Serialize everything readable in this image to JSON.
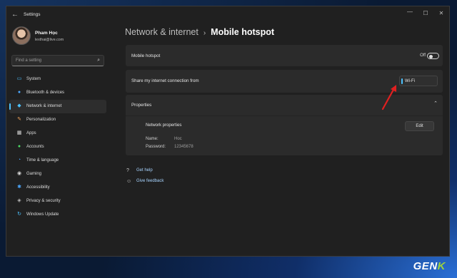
{
  "window": {
    "title": "Settings",
    "controls": {
      "minimize": "—",
      "maximize": "☐",
      "close": "✕"
    }
  },
  "user": {
    "name": "Pham Học",
    "email": "lexthai@live.com"
  },
  "search": {
    "placeholder": "Find a setting"
  },
  "sidebar": {
    "items": [
      {
        "label": "System",
        "icon": "system-icon",
        "color": "#4cc2ff"
      },
      {
        "label": "Bluetooth & devices",
        "icon": "bluetooth-icon",
        "color": "#4ca8ff"
      },
      {
        "label": "Network & internet",
        "icon": "wifi-icon",
        "color": "#4cc2ff",
        "active": true
      },
      {
        "label": "Personalization",
        "icon": "brush-icon",
        "color": "#f2a35a"
      },
      {
        "label": "Apps",
        "icon": "apps-icon",
        "color": "#d8d8d8"
      },
      {
        "label": "Accounts",
        "icon": "person-icon",
        "color": "#4cd964"
      },
      {
        "label": "Time & language",
        "icon": "clock-icon",
        "color": "#4ca8ff"
      },
      {
        "label": "Gaming",
        "icon": "controller-icon",
        "color": "#d8d8d8"
      },
      {
        "label": "Accessibility",
        "icon": "accessibility-icon",
        "color": "#4ca8ff"
      },
      {
        "label": "Privacy & security",
        "icon": "shield-icon",
        "color": "#bdbdbd"
      },
      {
        "label": "Windows Update",
        "icon": "update-icon",
        "color": "#4cc2ff"
      }
    ]
  },
  "breadcrumb": {
    "parent": "Network & internet",
    "separator": "›",
    "current": "Mobile hotspot"
  },
  "hotspot": {
    "label": "Mobile hotspot",
    "state_text": "Off",
    "enabled": false
  },
  "share": {
    "label": "Share my internet connection from",
    "selected": "Wi-Fi"
  },
  "properties": {
    "title": "Properties",
    "network_properties_label": "Network properties",
    "name_label": "Name:",
    "name_value": "Hoc",
    "password_label": "Password:",
    "password_value": "12345678",
    "edit_label": "Edit"
  },
  "links": {
    "help": "Get help",
    "feedback": "Give feedback"
  },
  "watermark": {
    "text_main": "GEN",
    "text_accent": "K"
  },
  "colors": {
    "accent": "#4cc2ff",
    "annotation_arrow": "#e02020"
  }
}
